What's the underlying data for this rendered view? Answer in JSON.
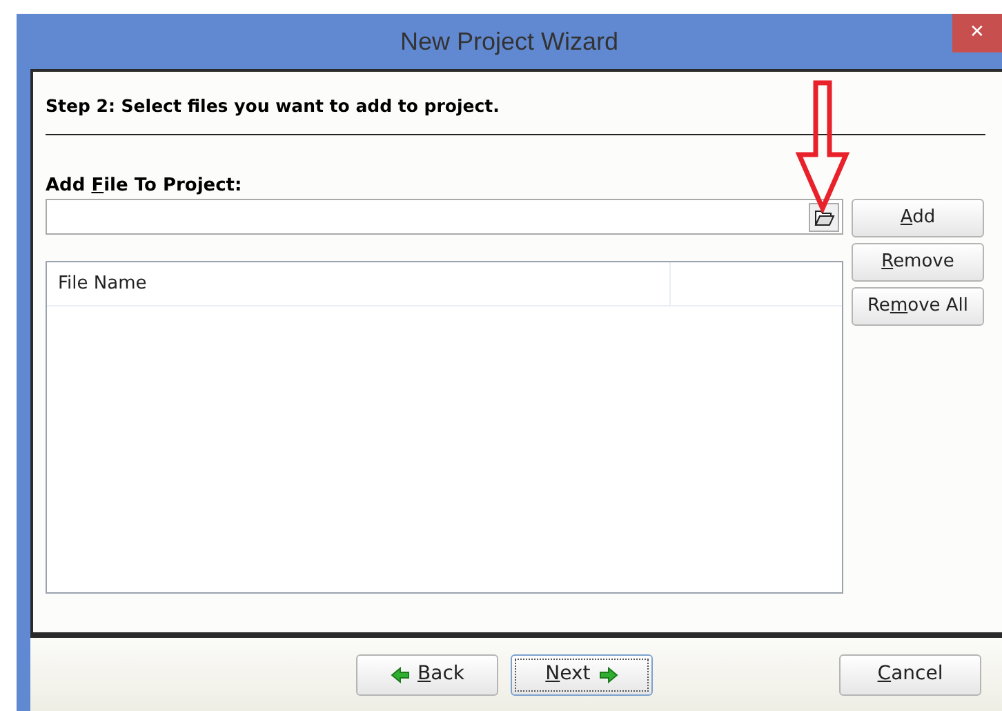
{
  "window": {
    "title": "New Project Wizard",
    "close": "✕"
  },
  "step_title": "Step 2: Select files you want to add to project.",
  "file_field": {
    "label": {
      "before": "Add ",
      "key": "F",
      "after": "ile To Project:"
    }
  },
  "side_buttons": [
    {
      "key": "A",
      "after": "dd"
    },
    {
      "key": "R",
      "after": "emove"
    },
    {
      "before": "Re",
      "key": "m",
      "after": "ove All"
    }
  ],
  "file_list": {
    "columns": [
      "File Name"
    ]
  },
  "annotation": {
    "kind": "arrow"
  },
  "footer_buttons": [
    {
      "kind": "back",
      "key": "B",
      "after": "ack",
      "focused": false
    },
    {
      "kind": "next",
      "key": "N",
      "after": "ext",
      "focused": true
    },
    {
      "kind": "cancel",
      "key": "C",
      "after": "ancel",
      "focused": false
    }
  ]
}
